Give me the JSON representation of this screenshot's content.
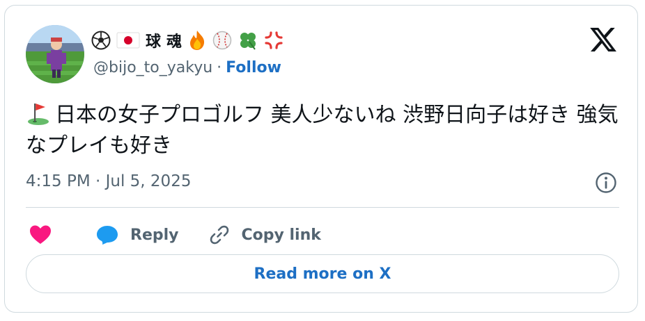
{
  "author": {
    "display_name_parts": [
      "⚽",
      "🇯🇵",
      "球",
      "魂",
      "🔥",
      "⚾",
      "🍀",
      "💢"
    ],
    "handle": "@bijo_to_yakyu",
    "separator": "·",
    "follow_label": "Follow"
  },
  "tweet": {
    "text": "日本の女子プロゴルフ  美人少ないね 渋野日向子は好き 強気なプレイも好き",
    "timestamp": "4:15 PM · Jul 5, 2025"
  },
  "actions": {
    "reply_label": "Reply",
    "copy_link_label": "Copy link"
  },
  "read_more_label": "Read more on X",
  "colors": {
    "link_blue": "#1d6fc4",
    "heart_pink": "#f91880",
    "reply_blue": "#1d9bf0",
    "muted": "#536471",
    "border": "#cfd9de"
  }
}
